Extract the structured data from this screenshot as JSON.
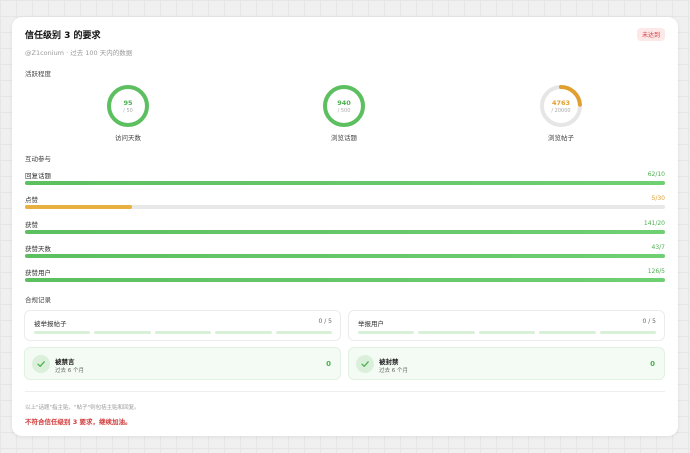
{
  "card": {
    "title": "信任级别 3 的要求",
    "badge": "未达到",
    "subtitle": "@Z1conium · 过去 100 天内的数据"
  },
  "activity": {
    "label": "活跃程度",
    "rings": [
      {
        "value": "95",
        "sub": "/ 50",
        "label": "访问天数",
        "progress": 1.0,
        "color": "#5cbf60"
      },
      {
        "value": "940",
        "sub": "/ 500",
        "label": "浏览话题",
        "progress": 1.0,
        "color": "#5cbf60"
      },
      {
        "value": "4763",
        "sub": "/ 20000",
        "label": "浏览帖子",
        "progress": 0.238,
        "color": "#e0a030"
      }
    ]
  },
  "interaction": {
    "label": "互动参与",
    "bars": [
      {
        "label": "回复话题",
        "value": "62/10",
        "progress": 1.0,
        "warn": false
      },
      {
        "label": "点赞",
        "value": "5/30",
        "progress": 0.167,
        "warn": true
      },
      {
        "label": "获赞",
        "value": "141/20",
        "progress": 1.0,
        "warn": false
      },
      {
        "label": "获赞天数",
        "value": "43/7",
        "progress": 1.0,
        "warn": false
      },
      {
        "label": "获赞用户",
        "value": "126/5",
        "progress": 1.0,
        "warn": false
      }
    ]
  },
  "compliance": {
    "label": "合规记录",
    "flagged_posts": {
      "label": "被举报帖子",
      "count": "0 / 5",
      "filled": 0,
      "segments": 5
    },
    "flagged_users": {
      "label": "举报用户",
      "count": "0 / 5",
      "filled": 0,
      "segments": 5
    },
    "silenced": {
      "title": "被禁言",
      "sub": "过去 6 个月",
      "value": "0"
    },
    "suspended": {
      "title": "被封禁",
      "sub": "过去 6 个月",
      "value": "0"
    }
  },
  "footer": {
    "note": "以上\"话题\"指主贴，\"帖子\"则包括主贴和回复。",
    "status": "不符合信任级别 3 要求，继续加油。"
  },
  "colors": {
    "accent_green": "#5cbf60",
    "warn_orange": "#e0a030",
    "fail_red": "#d23c3c"
  }
}
